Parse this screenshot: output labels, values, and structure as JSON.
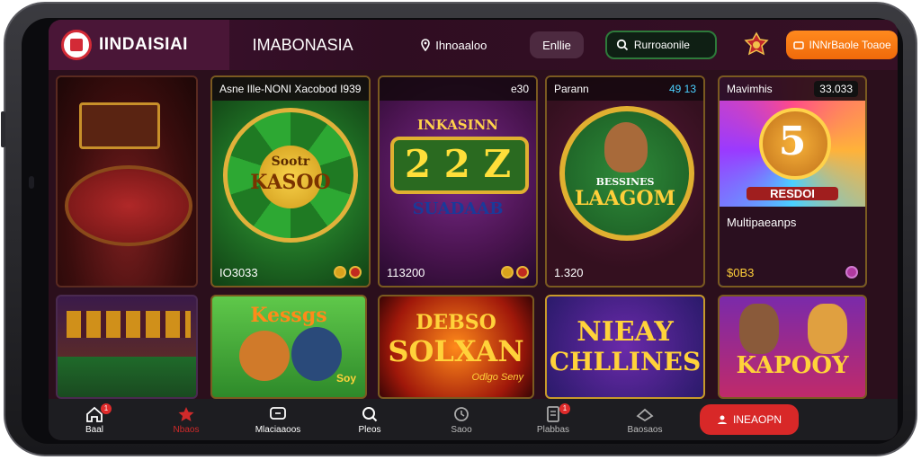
{
  "header": {
    "brand_name": "IINDAISIAI",
    "site_name": "IMABONASIA",
    "location_label": "Ihnoaaloo",
    "login_label": "Enllie",
    "search_label": "Rurroaonile",
    "cta_label": "INNrBaole Toaoe"
  },
  "cards": [
    {
      "title": "",
      "footer_value": ""
    },
    {
      "title": "Asne Ille-NONI Xacobod I939",
      "badge": "",
      "art_title": "Sootr",
      "art_sub": "KASOO",
      "footer_value": "IO3033"
    },
    {
      "title": "",
      "badge": "e30",
      "art_title": "INKASINN",
      "art_sub": "2 2 Z",
      "art_sub2": "SUADAAB",
      "footer_value": "113200"
    },
    {
      "title": "Parann",
      "badge": "49 13",
      "art_title": "BESSINES",
      "art_sub": "LAAGOM",
      "footer_value": "1.320"
    },
    {
      "title": "Mavimhis",
      "badge": "33.033",
      "art_title": "5",
      "art_sub": "RESDOI",
      "caption": "Multipaeanps",
      "footer_value": "$0B3"
    },
    {
      "title": "",
      "footer_value": ""
    },
    {
      "title": "",
      "art_title": "Kessgs",
      "art_sub": "Soy",
      "footer_value": ""
    },
    {
      "title": "",
      "art_title": "DEBSO",
      "art_sub": "SOLXAN",
      "art_sub2": "Odlgo Seny",
      "footer_value": ""
    },
    {
      "title": "",
      "art_title": "NIEAY",
      "art_sub": "CHLLINES",
      "footer_value": ""
    },
    {
      "title": "",
      "art_title": "KAPOOY",
      "footer_value": ""
    }
  ],
  "nav": {
    "items": [
      {
        "label": "Baal",
        "icon": "home-icon",
        "badge": "1"
      },
      {
        "label": "Nbaos",
        "icon": "star-icon",
        "badge": ""
      },
      {
        "label": "Mlaciaaoos",
        "icon": "chat-icon",
        "badge": ""
      },
      {
        "label": "Pleos",
        "icon": "search-icon",
        "badge": ""
      },
      {
        "label": "Saoo",
        "icon": "clock-icon",
        "badge": ""
      },
      {
        "label": "Plabbas",
        "icon": "document-icon",
        "badge": "1"
      },
      {
        "label": "Baosaos",
        "icon": "layers-icon",
        "badge": ""
      }
    ],
    "cta_label": "INEAOPN"
  },
  "colors": {
    "accent_orange": "#f06a0a",
    "accent_red": "#d82828",
    "search_green": "#2d7a3a",
    "header_bg": "#3e1230"
  }
}
